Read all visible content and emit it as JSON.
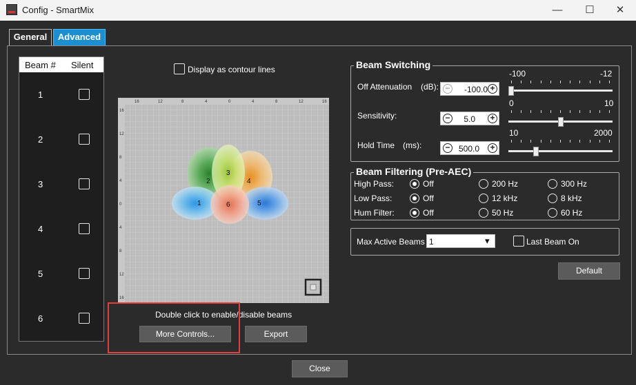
{
  "window": {
    "title": "Config - SmartMix",
    "minimize_glyph": "—",
    "maximize_glyph": "☐",
    "close_glyph": "✕"
  },
  "tabs": [
    {
      "label": "General",
      "selected": false
    },
    {
      "label": "Advanced",
      "selected": true
    }
  ],
  "beam_table": {
    "col_beam": "Beam #",
    "col_silent": "Silent",
    "rows": [
      {
        "beam": "1",
        "silent": false
      },
      {
        "beam": "2",
        "silent": false
      },
      {
        "beam": "3",
        "silent": false
      },
      {
        "beam": "4",
        "silent": false
      },
      {
        "beam": "5",
        "silent": false
      },
      {
        "beam": "6",
        "silent": false
      }
    ]
  },
  "contour": {
    "label": "Display as contour lines",
    "checked": false
  },
  "plot": {
    "x_ticks": [
      "16",
      "12",
      "8",
      "4",
      "0",
      "4",
      "8",
      "12",
      "16"
    ],
    "y_ticks": [
      "16",
      "12",
      "8",
      "4",
      "0",
      "4",
      "8",
      "12",
      "16"
    ],
    "beams": [
      {
        "label": "1",
        "color": "#4aa8e8"
      },
      {
        "label": "2",
        "color": "#3d9a3d"
      },
      {
        "label": "3",
        "color": "#9dcc3a"
      },
      {
        "label": "4",
        "color": "#f0a030"
      },
      {
        "label": "5",
        "color": "#3a88e0"
      },
      {
        "label": "6",
        "color": "#f08a6a"
      }
    ]
  },
  "hint": "Double click to enable/disable beams",
  "buttons": {
    "more_controls": "More Controls...",
    "export": "Export",
    "default": "Default",
    "close": "Close"
  },
  "beam_switching": {
    "title": "Beam Switching",
    "off_attenuation": {
      "label": "Off Attenuation",
      "unit": "(dB):",
      "value": "-100.0",
      "min": "-100",
      "max": "-12"
    },
    "sensitivity": {
      "label": "Sensitivity:",
      "value": "5.0",
      "min": "0",
      "max": "10"
    },
    "hold_time": {
      "label": "Hold Time",
      "unit": "(ms):",
      "value": "500.0",
      "min": "10",
      "max": "2000"
    },
    "slider_levels": [
      0.0,
      0.5,
      0.25
    ]
  },
  "beam_filtering": {
    "title": "Beam Filtering (Pre-AEC)",
    "rows": [
      {
        "label": "High Pass:",
        "options": [
          "Off",
          "200 Hz",
          "300 Hz"
        ],
        "selected": 0
      },
      {
        "label": "Low Pass:",
        "options": [
          "Off",
          "12 kHz",
          "8 kHz"
        ],
        "selected": 0
      },
      {
        "label": "Hum Filter:",
        "options": [
          "Off",
          "50 Hz",
          "60 Hz"
        ],
        "selected": 0
      }
    ]
  },
  "max_active_beams": {
    "label": "Max Active Beams",
    "value": "1",
    "dropdown_icon": "▾"
  },
  "last_beam_on": {
    "label": "Last Beam On",
    "checked": false
  },
  "accent_colors": {
    "tab_selected": "#1c8fd0",
    "highlight_box": "#e04040"
  }
}
